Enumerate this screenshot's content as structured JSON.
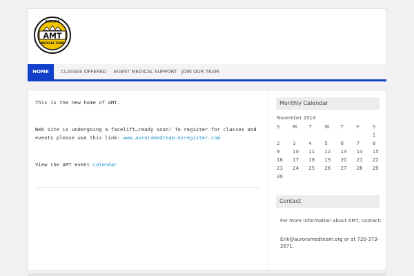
{
  "logo": {
    "top_text": "AURORA",
    "main_text": "AMT",
    "bottom_text": "MEDICAL TEAM",
    "colors": {
      "ring": "#111111",
      "fill": "#f2c500",
      "text": "#111111"
    }
  },
  "nav": {
    "items": [
      {
        "label": "HOME",
        "active": true
      },
      {
        "label": "CLASSES OFFERED",
        "active": false
      },
      {
        "label": "EVENT MEDICAL SUPPORT",
        "active": false
      },
      {
        "label": "JOIN OUR TEAM",
        "active": false
      }
    ],
    "accent": "#1240ca"
  },
  "main": {
    "line1": "This is the new home of AMT.",
    "line2": "Web site is undergoing a facelift…ready soon!   To register for classes and",
    "line3_prefix": "events please use this link: ",
    "line3_link": "www.auroramedteam.ezregister.com",
    "line4_prefix": "View the AMT event ",
    "line4_link": "calendar"
  },
  "sidebar": {
    "calendar": {
      "title": "Monthly Calendar",
      "caption": "November 2014",
      "weekdays": [
        "S",
        "M",
        "T",
        "W",
        "T",
        "F",
        "S"
      ],
      "weeks": [
        [
          "",
          "",
          "",
          "",
          "",
          "",
          "1"
        ],
        [
          "2",
          "3",
          "4",
          "5",
          "6",
          "7",
          "8"
        ],
        [
          "9",
          "10",
          "11",
          "12",
          "13",
          "14",
          "15"
        ],
        [
          "16",
          "17",
          "18",
          "19",
          "20",
          "21",
          "22"
        ],
        [
          "23",
          "24",
          "25",
          "26",
          "27",
          "28",
          "29"
        ],
        [
          "30",
          "",
          "",
          "",
          "",
          "",
          ""
        ]
      ]
    },
    "contact": {
      "title": "Contact",
      "line1": "For more information about AMT, contact:",
      "line2": "Erik@auroramedteam.org or at 720-373-",
      "line3": "2671."
    }
  }
}
